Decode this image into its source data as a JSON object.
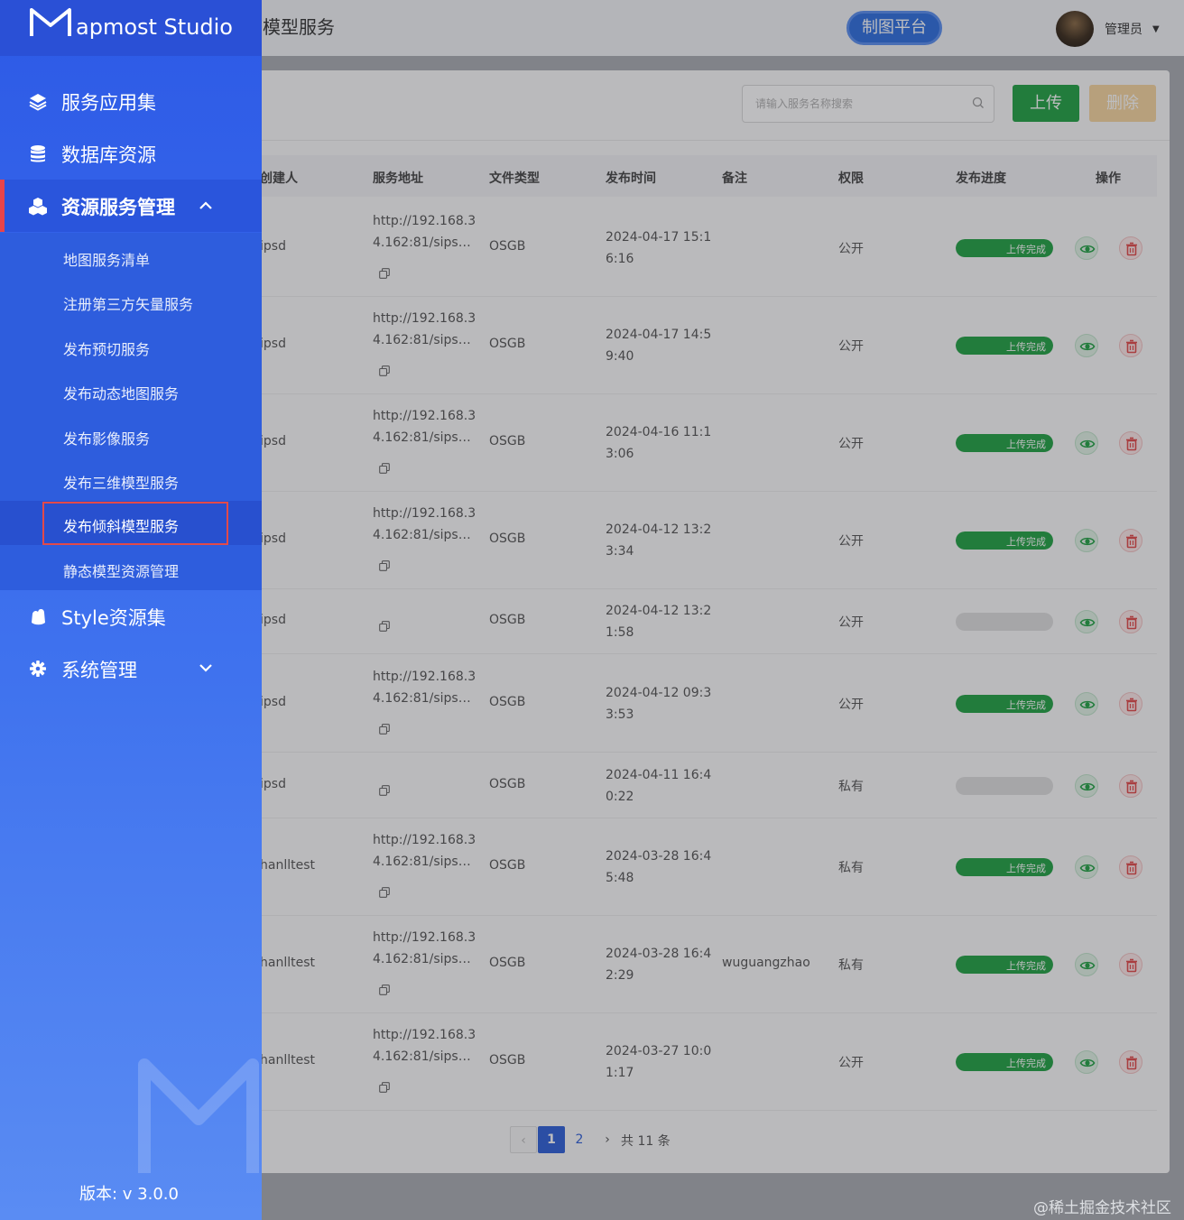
{
  "app": {
    "brand": "apmost Studio"
  },
  "header": {
    "breadcrumb": "模型服务",
    "platform_button": "制图平台",
    "user_name": "管理员"
  },
  "toolbar": {
    "search_placeholder": "请输入服务名称搜索",
    "upload_label": "上传",
    "delete_label": "删除"
  },
  "table": {
    "columns": [
      "创建人",
      "服务地址",
      "文件类型",
      "发布时间",
      "备注",
      "权限",
      "发布进度",
      "操作"
    ],
    "rows": [
      {
        "creator": "ipsd",
        "addr_line1": "http://192.168.3",
        "addr_line2": "4.162:81/sips…",
        "type": "OSGB",
        "time_line1": "2024-04-17 15:1",
        "time_line2": "6:16",
        "note": "",
        "perm": "公开",
        "progress": 1.0,
        "progress_text": "上传完成"
      },
      {
        "creator": "ipsd",
        "addr_line1": "http://192.168.3",
        "addr_line2": "4.162:81/sips…",
        "type": "OSGB",
        "time_line1": "2024-04-17 14:5",
        "time_line2": "9:40",
        "note": "",
        "perm": "公开",
        "progress": 1.0,
        "progress_text": "上传完成"
      },
      {
        "creator": "ipsd",
        "addr_line1": "http://192.168.3",
        "addr_line2": "4.162:81/sips…",
        "type": "OSGB",
        "time_line1": "2024-04-16 11:1",
        "time_line2": "3:06",
        "note": "",
        "perm": "公开",
        "progress": 1.0,
        "progress_text": "上传完成"
      },
      {
        "creator": "ipsd",
        "addr_line1": "http://192.168.3",
        "addr_line2": "4.162:81/sips…",
        "type": "OSGB",
        "time_line1": "2024-04-12 13:2",
        "time_line2": "3:34",
        "note": "",
        "perm": "公开",
        "progress": 1.0,
        "progress_text": "上传完成"
      },
      {
        "creator": "ipsd",
        "addr_line1": "",
        "addr_line2": "",
        "type": "OSGB",
        "time_line1": "2024-04-12 13:2",
        "time_line2": "1:58",
        "note": "",
        "perm": "公开",
        "progress": 0,
        "progress_text": ""
      },
      {
        "creator": "ipsd",
        "addr_line1": "http://192.168.3",
        "addr_line2": "4.162:81/sips…",
        "type": "OSGB",
        "time_line1": "2024-04-12 09:3",
        "time_line2": "3:53",
        "note": "",
        "perm": "公开",
        "progress": 1.0,
        "progress_text": "上传完成"
      },
      {
        "creator": "ipsd",
        "addr_line1": "",
        "addr_line2": "",
        "type": "OSGB",
        "time_line1": "2024-04-11 16:4",
        "time_line2": "0:22",
        "note": "",
        "perm": "私有",
        "progress": 0,
        "progress_text": ""
      },
      {
        "creator": "hanlltest",
        "addr_line1": "http://192.168.3",
        "addr_line2": "4.162:81/sips…",
        "type": "OSGB",
        "time_line1": "2024-03-28 16:4",
        "time_line2": "5:48",
        "note": "",
        "perm": "私有",
        "progress": 1.0,
        "progress_text": "上传完成"
      },
      {
        "creator": "hanlltest",
        "addr_line1": "http://192.168.3",
        "addr_line2": "4.162:81/sips…",
        "type": "OSGB",
        "time_line1": "2024-03-28 16:4",
        "time_line2": "2:29",
        "note": "wuguangzhao",
        "perm": "私有",
        "progress": 1.0,
        "progress_text": "上传完成"
      },
      {
        "creator": "hanlltest",
        "addr_line1": "http://192.168.3",
        "addr_line2": "4.162:81/sips…",
        "type": "OSGB",
        "time_line1": "2024-03-27 10:0",
        "time_line2": "1:17",
        "note": "",
        "perm": "公开",
        "progress": 1.0,
        "progress_text": "上传完成"
      }
    ]
  },
  "pagination": {
    "prev": "‹",
    "pages": [
      "1",
      "2"
    ],
    "next": "›",
    "total": "共 11 条"
  },
  "sidebar": {
    "items": [
      {
        "label": "服务应用集",
        "icon": "layers-icon"
      },
      {
        "label": "数据库资源",
        "icon": "database-icon"
      },
      {
        "label": "资源服务管理",
        "icon": "cubes-icon",
        "expanded": true
      },
      {
        "label": "Style资源集",
        "icon": "palette-icon"
      },
      {
        "label": "系统管理",
        "icon": "gear-icon"
      }
    ],
    "submenu": [
      "地图服务清单",
      "注册第三方矢量服务",
      "发布预切服务",
      "发布动态地图服务",
      "发布影像服务",
      "发布三维模型服务",
      "发布倾斜模型服务",
      "静态模型资源管理"
    ],
    "active_submenu": "发布倾斜模型服务",
    "version": "版本:  v 3.0.0"
  },
  "watermark": "@稀土掘金技术社区",
  "colors": {
    "sidebar": "#3a68e9",
    "accent_red": "#e24a4a",
    "success": "#22a244",
    "warning": "#f6d69f",
    "page_active": "#2f60d8"
  }
}
